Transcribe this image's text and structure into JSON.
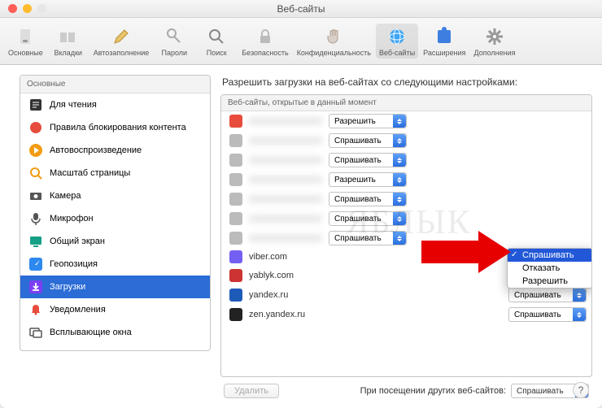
{
  "window_title": "Веб-сайты",
  "toolbar": [
    {
      "id": "general",
      "label": "Основные",
      "icon": "switch"
    },
    {
      "id": "tabs",
      "label": "Вкладки",
      "icon": "tab"
    },
    {
      "id": "autofill",
      "label": "Автозаполнение",
      "icon": "pencil"
    },
    {
      "id": "passwords",
      "label": "Пароли",
      "icon": "key"
    },
    {
      "id": "search",
      "label": "Поиск",
      "icon": "magnifier"
    },
    {
      "id": "security",
      "label": "Безопасность",
      "icon": "lock"
    },
    {
      "id": "privacy",
      "label": "Конфиденциальность",
      "icon": "hand"
    },
    {
      "id": "websites",
      "label": "Веб-сайты",
      "icon": "globe",
      "active": true
    },
    {
      "id": "extensions",
      "label": "Расширения",
      "icon": "puzzle"
    },
    {
      "id": "advanced",
      "label": "Дополнения",
      "icon": "gear"
    }
  ],
  "sidebar": {
    "header": "Основные",
    "items": [
      {
        "label": "Для чтения",
        "icon": "reader",
        "color": "#333"
      },
      {
        "label": "Правила блокирования контента",
        "icon": "block",
        "color": "#e74c3c"
      },
      {
        "label": "Автовоспроизведение",
        "icon": "play",
        "color": "#f39c12"
      },
      {
        "label": "Масштаб страницы",
        "icon": "zoom",
        "color": "#f39c12"
      },
      {
        "label": "Камера",
        "icon": "camera",
        "color": "#555"
      },
      {
        "label": "Микрофон",
        "icon": "mic",
        "color": "#555"
      },
      {
        "label": "Общий экран",
        "icon": "screen",
        "color": "#16a085"
      },
      {
        "label": "Геопозиция",
        "icon": "nav",
        "color": "#2d89ef"
      },
      {
        "label": "Загрузки",
        "icon": "download",
        "color": "#7b3ff2",
        "selected": true
      },
      {
        "label": "Уведомления",
        "icon": "bell",
        "color": "#e74c3c"
      },
      {
        "label": "Всплывающие окна",
        "icon": "popup",
        "color": "#555"
      }
    ]
  },
  "main": {
    "heading": "Разрешить загрузки на веб-сайтах со следующими настройками:",
    "list_header": "Веб-сайты, открытые в данный момент",
    "rows": [
      {
        "blurred": true,
        "iconColor": "#e74c3c",
        "setting": "Разрешить"
      },
      {
        "blurred": true,
        "iconColor": "#bbb",
        "setting": "Спрашивать"
      },
      {
        "blurred": true,
        "iconColor": "#bbb",
        "setting": "Спрашивать"
      },
      {
        "blurred": true,
        "iconColor": "#bbb",
        "setting": "Разрешить"
      },
      {
        "blurred": true,
        "iconColor": "#bbb",
        "setting": "Спрашивать"
      },
      {
        "blurred": true,
        "iconColor": "#bbb",
        "setting": "Спрашивать"
      },
      {
        "blurred": true,
        "iconColor": "#bbb",
        "setting": "Спрашивать"
      },
      {
        "name": "viber.com",
        "iconColor": "#7360f2",
        "setting": "",
        "menuOpen": true
      },
      {
        "name": "yablyk.com",
        "iconColor": "#cc3333",
        "setting": "Спрашивать"
      },
      {
        "name": "yandex.ru",
        "iconColor": "#1e5bb8",
        "setting": "Спрашивать"
      },
      {
        "name": "zen.yandex.ru",
        "iconColor": "#222",
        "setting": "Спрашивать"
      }
    ],
    "menu_options": [
      "Спрашивать",
      "Отказать",
      "Разрешить"
    ],
    "menu_selected_index": 0,
    "delete_button": "Удалить",
    "footer_label": "При посещении других веб-сайтов:",
    "footer_setting": "Спрашивать"
  },
  "watermark": "БЛЫК"
}
